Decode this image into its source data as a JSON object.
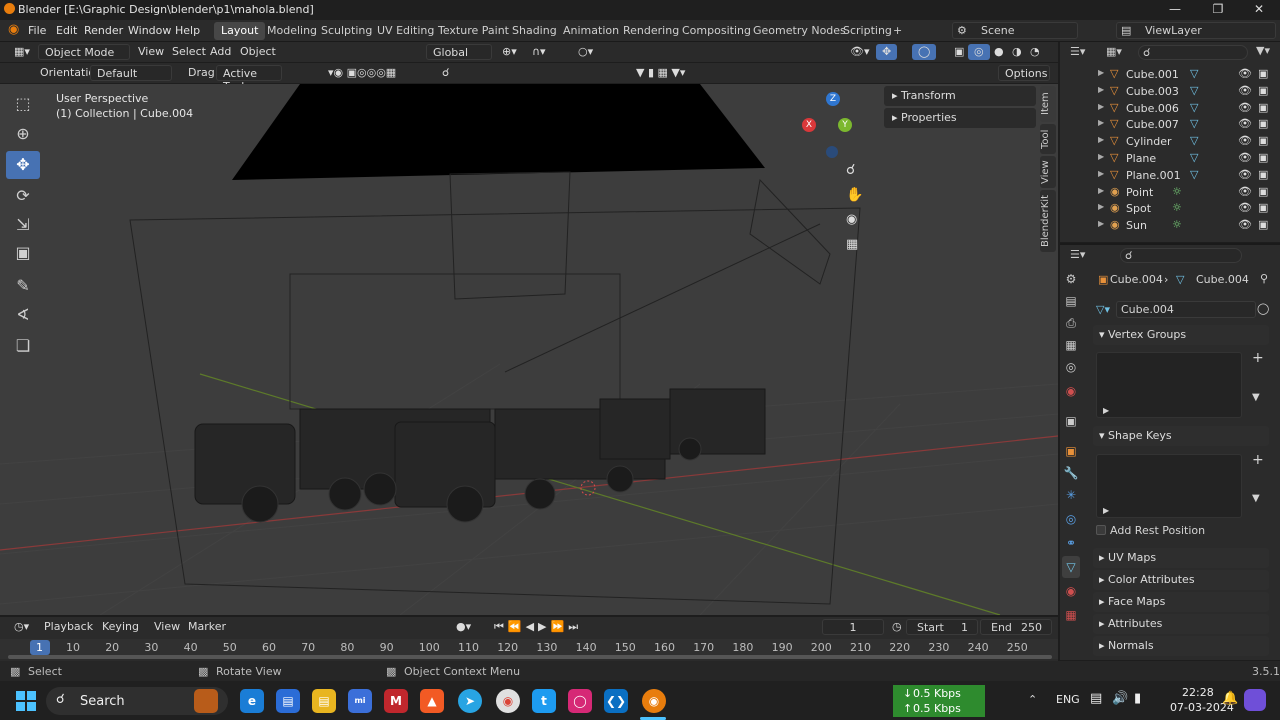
{
  "window": {
    "title": "Blender [E:\\Graphic Design\\blender\\p1\\mahola.blend]"
  },
  "menubar": {
    "items": [
      "File",
      "Edit",
      "Render",
      "Window",
      "Help"
    ],
    "workspaces": [
      "Layout",
      "Modeling",
      "Sculpting",
      "UV Editing",
      "Texture Paint",
      "Shading",
      "Animation",
      "Rendering",
      "Compositing",
      "Geometry Nodes",
      "Scripting"
    ],
    "add_tab": "+",
    "scene": "Scene",
    "view_layer": "ViewLayer"
  },
  "viewport_header": {
    "mode": "Object Mode",
    "menus": [
      "View",
      "Select",
      "Add",
      "Object"
    ],
    "transform_orientation": "Global"
  },
  "tool_settings": {
    "orientation_label": "Orientation:",
    "orientation_value": "Default",
    "drag_label": "Drag:",
    "drag_value": "Active Tool",
    "options": "Options"
  },
  "viewport": {
    "view_name": "User Perspective",
    "collection_info": "(1) Collection | Cube.004",
    "n_panel_tabs": [
      "Item",
      "Tool",
      "View",
      "BlenderKit"
    ],
    "panels": [
      "Transform",
      "Properties"
    ],
    "gizmo": {
      "x": "X",
      "y": "Y",
      "z": "Z"
    }
  },
  "outliner": {
    "rows": [
      {
        "name": "Cube.001",
        "type": "mesh"
      },
      {
        "name": "Cube.003",
        "type": "mesh"
      },
      {
        "name": "Cube.006",
        "type": "mesh"
      },
      {
        "name": "Cube.007",
        "type": "mesh"
      },
      {
        "name": "Cylinder",
        "type": "mesh"
      },
      {
        "name": "Plane",
        "type": "mesh"
      },
      {
        "name": "Plane.001",
        "type": "mesh"
      },
      {
        "name": "Point",
        "type": "light"
      },
      {
        "name": "Spot",
        "type": "light"
      },
      {
        "name": "Sun",
        "type": "light"
      }
    ]
  },
  "properties": {
    "breadcrumb_object": "Cube.004",
    "breadcrumb_mesh": "Cube.004",
    "mesh_name": "Cube.004",
    "vertex_groups": "Vertex Groups",
    "shape_keys": "Shape Keys",
    "add_rest_position": "Add Rest Position",
    "collapsed": [
      "UV Maps",
      "Color Attributes",
      "Face Maps",
      "Attributes",
      "Normals"
    ]
  },
  "timeline": {
    "menus": [
      "Playback",
      "Keying",
      "View",
      "Marker"
    ],
    "current_frame": "1",
    "start_label": "Start",
    "start": "1",
    "end_label": "End",
    "end": "250",
    "ticks": [
      "1",
      "10",
      "20",
      "30",
      "40",
      "50",
      "60",
      "70",
      "80",
      "90",
      "100",
      "110",
      "120",
      "130",
      "140",
      "150",
      "160",
      "170",
      "180",
      "190",
      "200",
      "210",
      "220",
      "230",
      "240",
      "250"
    ]
  },
  "statusbar": {
    "select": "Select",
    "rotate": "Rotate View",
    "context": "Object Context Menu",
    "version": "3.5.1"
  },
  "taskbar": {
    "search": "Search",
    "net_down": "0.5 Kbps",
    "net_up": "0.5 Kbps",
    "lang": "ENG",
    "time": "22:28",
    "date": "07-03-2024"
  }
}
